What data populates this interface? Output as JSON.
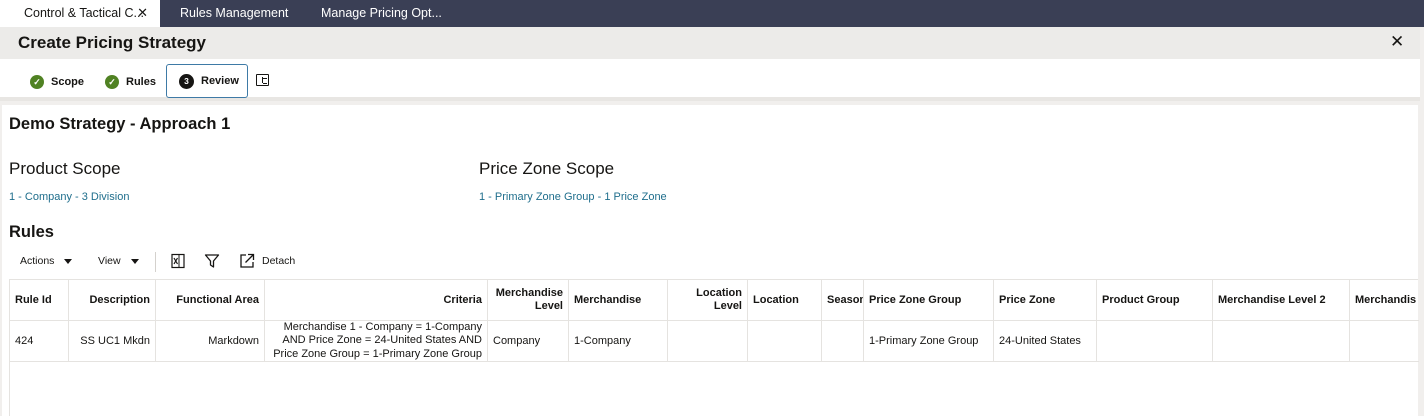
{
  "tabs": [
    {
      "label": "Control & Tactical C...",
      "close": "✕"
    },
    {
      "label": "Rules Management"
    },
    {
      "label": "Manage Pricing Opt..."
    }
  ],
  "header": {
    "title": "Create Pricing Strategy",
    "close": "✕"
  },
  "train": {
    "steps": [
      {
        "label": "Scope",
        "status": "complete"
      },
      {
        "label": "Rules",
        "status": "complete"
      },
      {
        "label": "Review",
        "number": "3",
        "status": "current"
      }
    ]
  },
  "strategy": {
    "title": "Demo Strategy - Approach 1"
  },
  "product_scope": {
    "title": "Product Scope",
    "link": "1 - Company - 3 Division"
  },
  "price_zone_scope": {
    "title": "Price Zone Scope",
    "link": "1 - Primary Zone Group - 1 Price Zone"
  },
  "rules": {
    "title": "Rules",
    "toolbar": {
      "actions": "Actions",
      "view": "View",
      "detach": "Detach"
    },
    "columns": [
      "Rule Id",
      "Description",
      "Functional Area",
      "Criteria",
      "Merchandise Level",
      "Merchandise",
      "Location Level",
      "Location",
      "Season",
      "Price Zone Group",
      "Price Zone",
      "Product Group",
      "Merchandise Level 2",
      "Merchandis"
    ],
    "rows": [
      {
        "rule_id": "424",
        "description": "SS UC1 Mkdn",
        "functional_area": "Markdown",
        "criteria": "Merchandise 1 - Company = 1-Company AND Price Zone = 24-United States AND Price Zone Group = 1-Primary Zone Group",
        "merchandise_level": "Company",
        "merchandise": "1-Company",
        "location_level": "",
        "location": "",
        "season": "",
        "price_zone_group": "1-Primary Zone Group",
        "price_zone": "24-United States",
        "product_group": "",
        "merchandise_level_2": "",
        "merchandise_3": ""
      }
    ]
  },
  "colors": {
    "tabbar": "#3a3f55",
    "check": "#508223",
    "link": "#1f6e8c",
    "focus": "#3e7aa6"
  }
}
